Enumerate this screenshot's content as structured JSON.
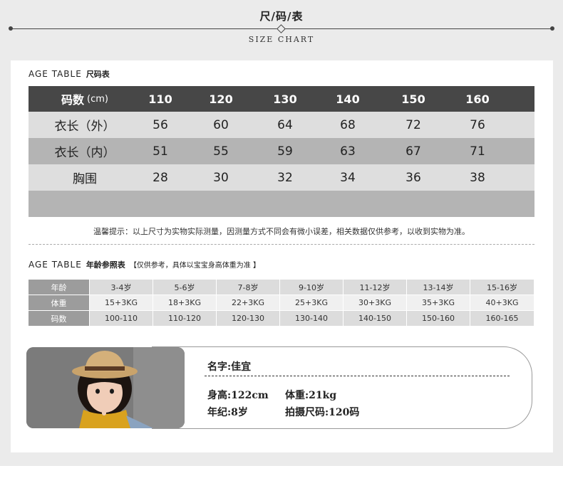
{
  "header": {
    "title": "尺/码/表",
    "subtitle": "SIZE CHART"
  },
  "size_section": {
    "label_en": "AGE TABLE",
    "label_zh": "尺码表",
    "columns": [
      "码数",
      "110",
      "120",
      "130",
      "140",
      "150",
      "160"
    ],
    "unit": "(cm)",
    "rows": [
      {
        "name": "衣长（外）",
        "values": [
          "56",
          "60",
          "64",
          "68",
          "72",
          "76"
        ]
      },
      {
        "name": "衣长（内）",
        "values": [
          "51",
          "55",
          "59",
          "63",
          "67",
          "71"
        ]
      },
      {
        "name": "胸围",
        "values": [
          "28",
          "30",
          "32",
          "34",
          "36",
          "38"
        ]
      }
    ],
    "tip": "温馨提示：以上尺寸为实物实际测量，因测量方式不同会有微小误差，相关数据仅供参考，以收到实物为准。"
  },
  "age_section": {
    "label_en": "AGE TABLE",
    "label_zh": "年龄参照表",
    "note": "【仅供参考，具体以宝宝身高体重为准 】",
    "rows": [
      {
        "name": "年龄",
        "values": [
          "3-4岁",
          "5-6岁",
          "7-8岁",
          "9-10岁",
          "11-12岁",
          "13-14岁",
          "15-16岁"
        ]
      },
      {
        "name": "体重",
        "values": [
          "15+3KG",
          "18+3KG",
          "22+3KG",
          "25+3KG",
          "30+3KG",
          "35+3KG",
          "40+3KG"
        ]
      },
      {
        "name": "码数",
        "values": [
          "100-110",
          "110-120",
          "120-130",
          "130-140",
          "140-150",
          "150-160",
          "160-165"
        ]
      }
    ]
  },
  "model": {
    "name": "名字:佳宜",
    "height": "身高:122cm",
    "weight": "体重:21kg",
    "age": "年纪:8岁",
    "shoot_size": "拍摄尺码:120码"
  },
  "colors": {
    "table_header": "#474747",
    "row_light": "#dedede",
    "row_dark": "#b4b4b4",
    "age_label": "#9c9c9c",
    "page_bg": "#ebebeb"
  }
}
